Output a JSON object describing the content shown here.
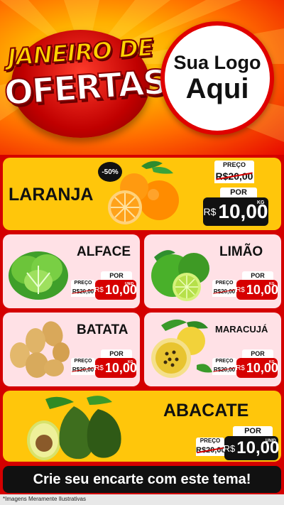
{
  "header": {
    "title_line1": "JANEIRO DE",
    "title_line2": "OFERTAS",
    "logo_line1": "Sua Logo",
    "logo_line2": "Aqui"
  },
  "products": [
    {
      "name": "LARANJA",
      "badge": "-50%",
      "preco_label": "PREÇO",
      "old_price": "R$20,00",
      "por_label": "POR",
      "currency": "R$",
      "price": "10,00",
      "unit": "KG"
    },
    {
      "name": "ALFACE",
      "preco_label": "PREÇO",
      "old_price": "R$20,00",
      "por_label": "POR",
      "currency": "R$",
      "price": "10,00",
      "unit": "UNID"
    },
    {
      "name": "LIMÃO",
      "preco_label": "PREÇO",
      "old_price": "R$20,00",
      "por_label": "POR",
      "currency": "R$",
      "price": "10,00",
      "unit": "KG"
    },
    {
      "name": "BATATA",
      "preco_label": "PREÇO",
      "old_price": "R$20,00",
      "por_label": "POR",
      "currency": "R$",
      "price": "10,00",
      "unit": "KG"
    },
    {
      "name": "MARACUJÁ",
      "preco_label": "PREÇO",
      "old_price": "R$20,00",
      "por_label": "POR",
      "currency": "R$",
      "price": "10,00",
      "unit": "KG"
    },
    {
      "name": "ABACATE",
      "preco_label": "PREÇO",
      "old_price": "R$20,00",
      "por_label": "POR",
      "currency": "R$",
      "price": "10,00",
      "unit": "UNID"
    }
  ],
  "cta": "Crie seu encarte com este tema!",
  "disclaimer": "*Imagens Meramente Ilustrativas",
  "colors": {
    "red": "#d40000",
    "yellow": "#ffc60b",
    "pink": "#ffe1e6",
    "black": "#111111"
  }
}
